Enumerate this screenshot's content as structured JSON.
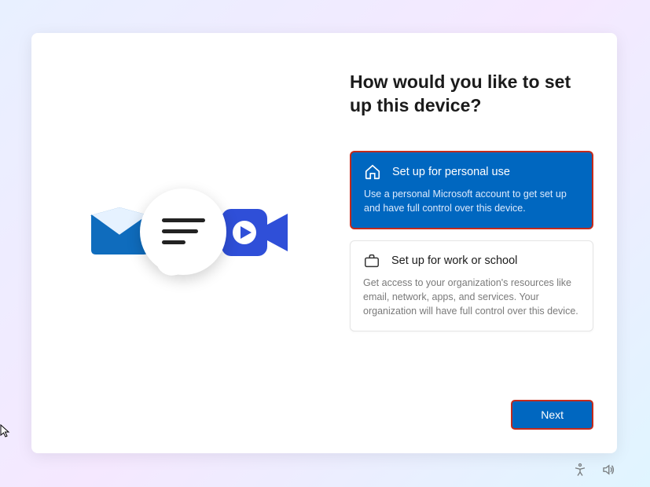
{
  "heading": "How would you like to set up this device?",
  "options": {
    "personal": {
      "title": "Set up for personal use",
      "description": "Use a personal Microsoft account to get set up and have full control over this device."
    },
    "work": {
      "title": "Set up for work or school",
      "description": "Get access to your organization's resources like email, network, apps, and services. Your organization will have full control over this device."
    }
  },
  "buttons": {
    "next": "Next"
  }
}
